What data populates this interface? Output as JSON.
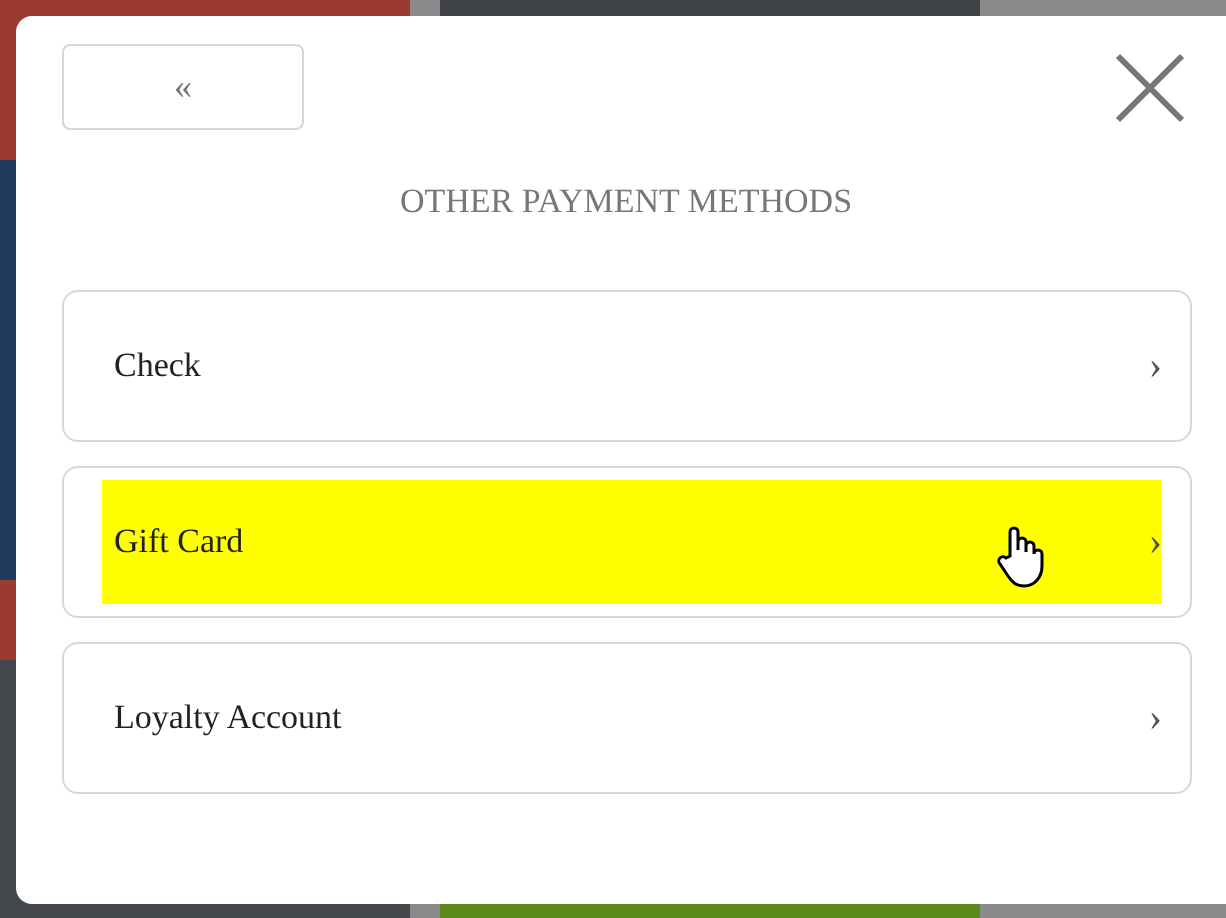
{
  "dialog": {
    "back_button": "«",
    "title": "OTHER PAYMENT METHODS",
    "methods": [
      {
        "label": "Check",
        "chevron": "›",
        "selected": false
      },
      {
        "label": "Gift Card",
        "chevron": "›",
        "selected": true
      },
      {
        "label": "Loyalty Account",
        "chevron": "›",
        "selected": false
      }
    ]
  }
}
